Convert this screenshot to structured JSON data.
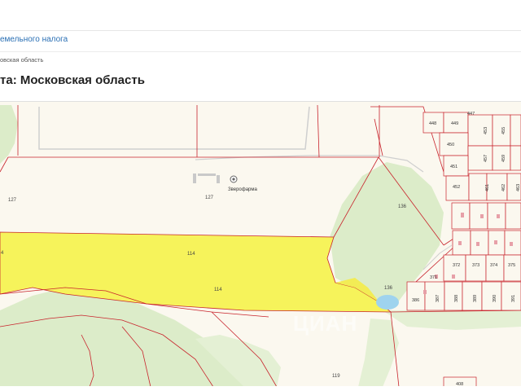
{
  "breadcrumb": {
    "link_label": "емельного налога",
    "region_crumb": "овская область"
  },
  "page": {
    "title": "та: Московская область"
  },
  "map": {
    "poi_label": "Зверофарма",
    "watermark": "ЦИАН",
    "plot_labels": {
      "p127a": "127",
      "p127b": "127",
      "p114a": "114",
      "p114b": "114",
      "p4": "4",
      "p136a": "136",
      "p136b": "136",
      "p119": "119",
      "p386": "386",
      "p387": "387",
      "p388": "388",
      "p389": "389",
      "p390": "390",
      "p391": "391",
      "p371": "371",
      "p372": "372",
      "p373": "373",
      "p374": "374",
      "p375": "375",
      "p447": "447",
      "p448": "448",
      "p449": "449",
      "p450": "450",
      "p451": "451",
      "p452": "452",
      "p453": "453",
      "p455": "455",
      "p457": "457",
      "p459": "459",
      "p461": "461",
      "p462": "462",
      "p463": "463",
      "p408": "408"
    },
    "colors": {
      "land": "#fbf8ef",
      "forest": "#dcecc9",
      "yellow_plot": "#f6f35b",
      "boundary": "#c8232c",
      "water": "#9fd3ee",
      "road": "#cfcfcf"
    }
  }
}
